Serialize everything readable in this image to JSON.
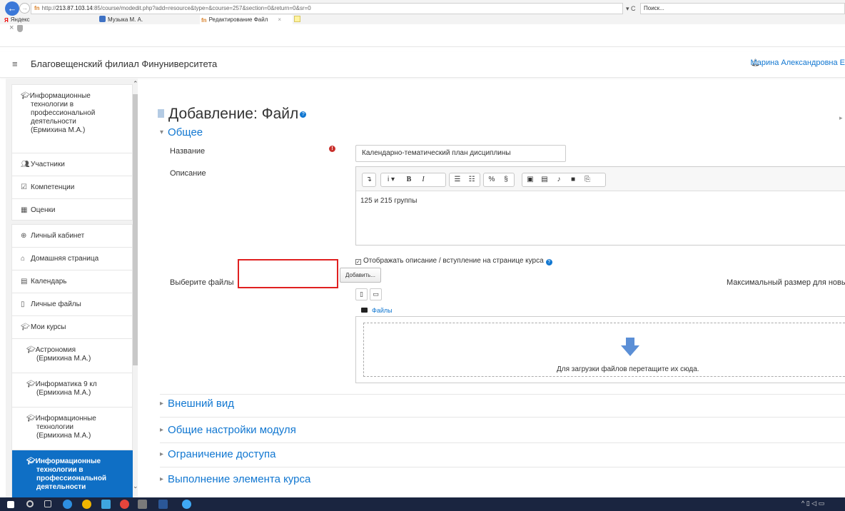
{
  "browser": {
    "url_prefix": "http://",
    "url_host": "213.87.103.14",
    "url_rest": ":85/course/modedit.php?add=resource&type=&course=257&section=0&return=0&sr=0",
    "refresh_label": "▾ C",
    "search_placeholder": "Поиск...",
    "tabs": [
      {
        "label": "Яндекс"
      },
      {
        "label": "Музыка М. А."
      },
      {
        "label": "Редактирование Файл"
      }
    ]
  },
  "header": {
    "site_name": "Благовещенский филиал Финуниверситета",
    "user_name": "Марина Александровна Е"
  },
  "sidebar": {
    "course_block": [
      {
        "label": "Информационные технологии в профессиональной деятельности (Ермихина М.А.)",
        "lines": [
          "Информационные",
          "технологии в",
          "профессиональной",
          "деятельности",
          "(Ермихина М.А.)"
        ]
      },
      {
        "label": "Участники"
      },
      {
        "label": "Компетенции"
      },
      {
        "label": "Оценки"
      }
    ],
    "site_block": [
      {
        "label": "Личный кабинет"
      },
      {
        "label": "Домашняя страница"
      },
      {
        "label": "Календарь"
      },
      {
        "label": "Личные файлы"
      },
      {
        "label": "Мои курсы"
      }
    ],
    "courses": [
      {
        "lines": [
          "Астрономия",
          "(Ермихина М.А.)"
        ]
      },
      {
        "lines": [
          "Информатика 9 кл",
          "(Ермихина М.А.)"
        ]
      },
      {
        "lines": [
          "Информационные",
          "технологии",
          "(Ермихина М.А.)"
        ]
      },
      {
        "lines": [
          "Информационные",
          "технологии в",
          "профессиональной",
          "деятельности"
        ]
      }
    ]
  },
  "main": {
    "page_title": "Добавление: Файл",
    "sections": {
      "general": "Общее",
      "appearance": "Внешний вид",
      "module_settings": "Общие настройки модуля",
      "access": "Ограничение доступа",
      "completion": "Выполнение элемента курса"
    },
    "labels": {
      "name": "Название",
      "description": "Описание",
      "select_files": "Выберите файлы"
    },
    "name_value": "Календарно-тематический план дисциплины",
    "description_text": "125 и 215 группы",
    "show_description_label": "Отображать описание / вступление на странице курса",
    "add_button": "Добавить...",
    "max_size_label": "Максимальный размер для новых ф",
    "files_folder": "Файлы",
    "drop_text": "Для загрузки файлов перетащите их сюда.",
    "annotation_color": "#e02020",
    "accent_color": "#1177d1"
  }
}
